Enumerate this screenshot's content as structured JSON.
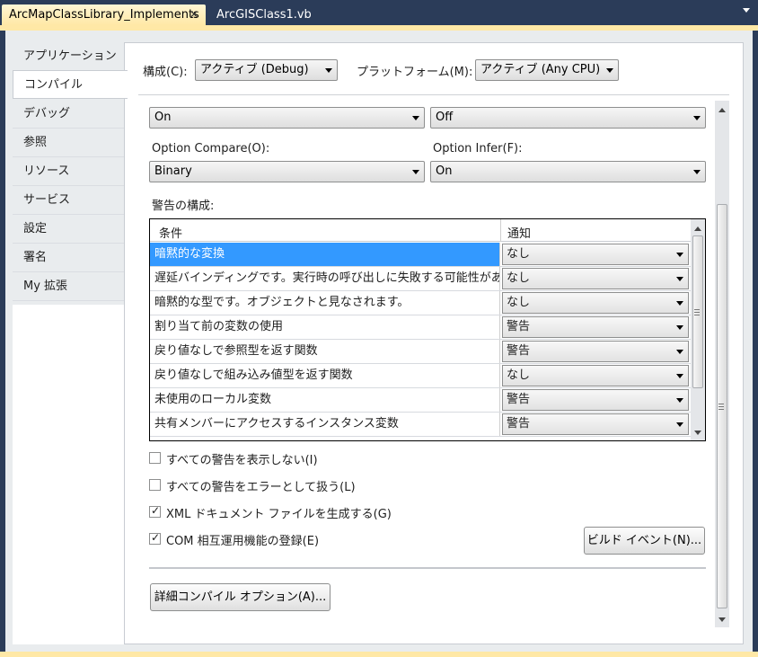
{
  "tabs": {
    "active": "ArcMapClassLibrary_Implements",
    "close_glyph": "✕",
    "inactive": "ArcGISClass1.vb"
  },
  "sidebar": {
    "items": [
      {
        "label": "アプリケーション"
      },
      {
        "label": "コンパイル"
      },
      {
        "label": "デバッグ"
      },
      {
        "label": "参照"
      },
      {
        "label": "リソース"
      },
      {
        "label": "サービス"
      },
      {
        "label": "設定"
      },
      {
        "label": "署名"
      },
      {
        "label": "My 拡張"
      }
    ],
    "selected_index": 1
  },
  "toolbar": {
    "config_label": "構成(C):",
    "config_value": "アクティブ (Debug)",
    "platform_label": "プラットフォーム(M):",
    "platform_value": "アクティブ (Any CPU)"
  },
  "options": {
    "option_top_left_value": "On",
    "option_top_right_value": "Off",
    "option_compare_label": "Option Compare(O):",
    "option_compare_value": "Binary",
    "option_infer_label": "Option Infer(F):",
    "option_infer_value": "On"
  },
  "warnings": {
    "section_label": "警告の構成:",
    "col_condition": "条件",
    "col_notice": "通知",
    "rows": [
      {
        "condition": "暗黙的な変換",
        "notice": "なし"
      },
      {
        "condition": "遅延バインディングです。実行時の呼び出しに失敗する可能性があ...",
        "notice": "なし"
      },
      {
        "condition": "暗黙的な型です。オブジェクトと見なされます。",
        "notice": "なし"
      },
      {
        "condition": "割り当て前の変数の使用",
        "notice": "警告"
      },
      {
        "condition": "戻り値なしで参照型を返す関数",
        "notice": "警告"
      },
      {
        "condition": "戻り値なしで組み込み値型を返す関数",
        "notice": "なし"
      },
      {
        "condition": "未使用のローカル変数",
        "notice": "警告"
      },
      {
        "condition": "共有メンバーにアクセスするインスタンス変数",
        "notice": "警告"
      }
    ],
    "selected_row": 0
  },
  "checkboxes": {
    "suppress_all": {
      "label": "すべての警告を表示しない(I)",
      "checked": false
    },
    "treat_as_errors": {
      "label": "すべての警告をエラーとして扱う(L)",
      "checked": false
    },
    "generate_xml": {
      "label": "XML ドキュメント ファイルを生成する(G)",
      "checked": true
    },
    "register_com": {
      "label": "COM 相互運用機能の登録(E)",
      "checked": true
    }
  },
  "buttons": {
    "build_events": "ビルド イベント(N)...",
    "advanced_compile": "詳細コンパイル オプション(A)..."
  }
}
